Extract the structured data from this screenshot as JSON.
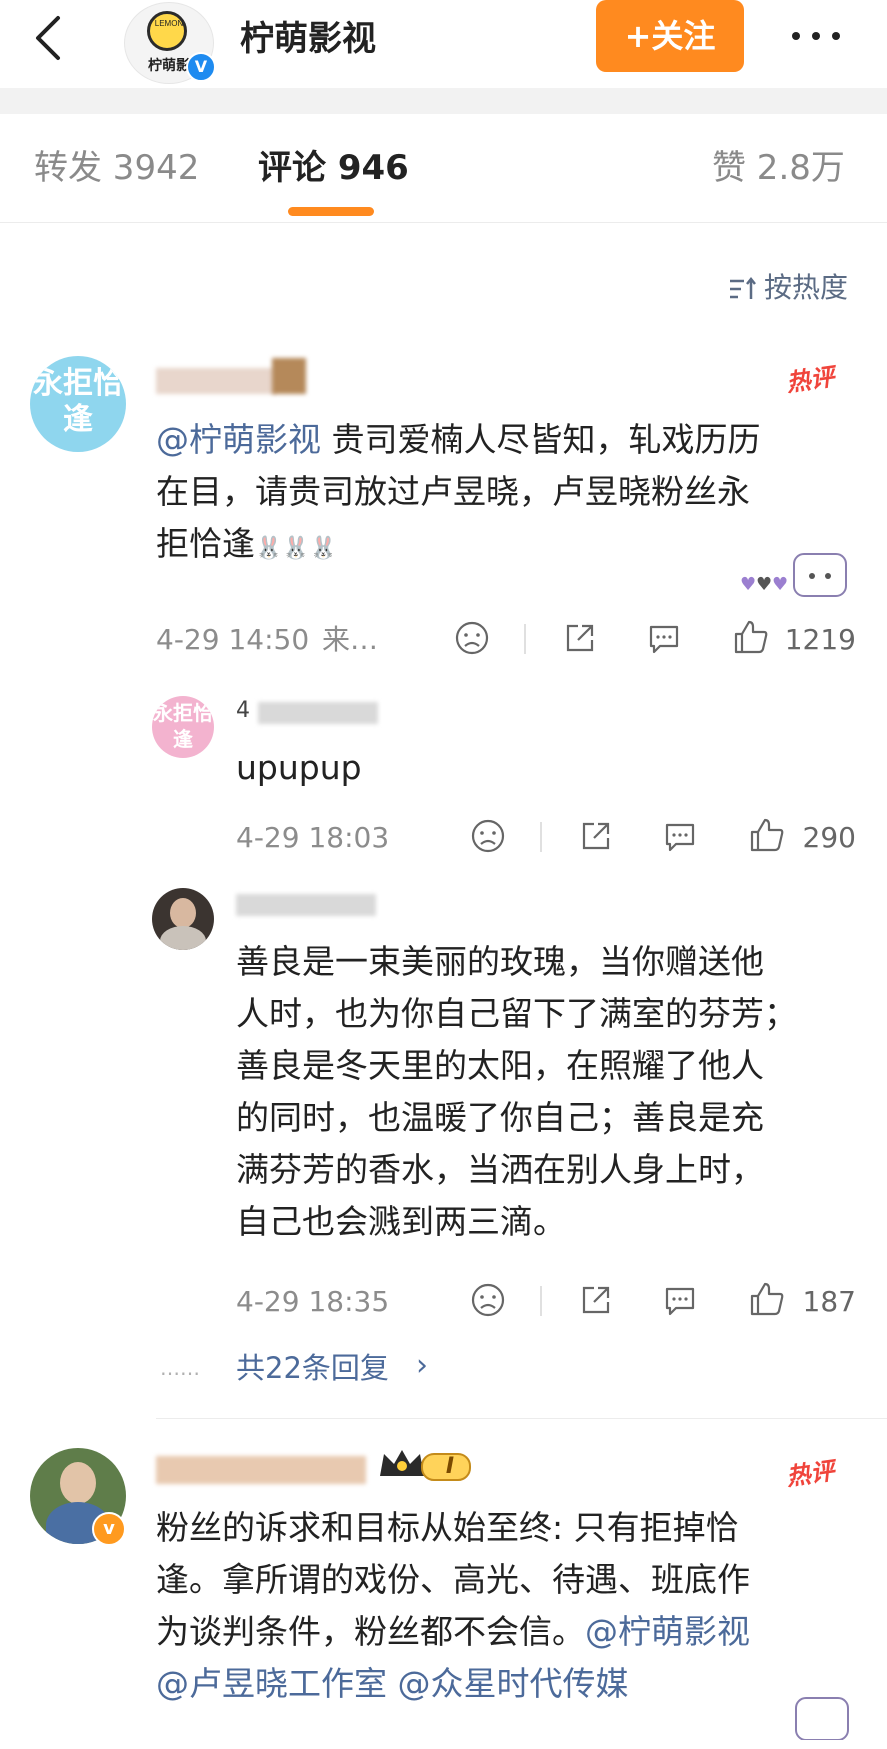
{
  "header": {
    "account_name": "柠萌影视",
    "logo_text_en": "LEMON",
    "logo_text_cn": "柠萌影",
    "verified_mark": "V",
    "follow_label": "+关注"
  },
  "tabs": {
    "repost": "转发 3942",
    "comments": "评论 946",
    "likes": "赞 2.8万"
  },
  "sort": {
    "label": "按热度"
  },
  "colors": {
    "accent": "#ff8a1f",
    "mention": "#4c6a9a",
    "hot": "#f0443b",
    "muted": "#8c8c8c"
  },
  "comments": [
    {
      "hot_label": "热评",
      "avatar_text": "永拒恰逢",
      "mention": "@柠萌影视",
      "text_line1": " 贵司爱楠人尽皆知，轧戏历历",
      "text_line2": "在目，请贵司放过卢昱晓，卢昱晓粉丝永",
      "text_line3": "拒恰逢",
      "time": "4-29 14:50",
      "source": "来…",
      "likes": "1219"
    },
    {
      "hot_label": "热评",
      "text_line1": "粉丝的诉求和目标从始至终: 只有拒掉恰",
      "text_line2": "逢。拿所谓的戏份、高光、待遇、班底作",
      "text_line3a": "为谈判条件，粉丝都不会信。",
      "mention1": "@柠萌影视",
      "mention2": "@卢昱晓工作室",
      "mention3": "@众星时代传媒",
      "badge_text": "I"
    }
  ],
  "replies": [
    {
      "avatar_text": "永拒恰逢",
      "name_fragment": "4",
      "text": "upupup",
      "time": "4-29 18:03",
      "likes": "290"
    },
    {
      "lines": [
        "善良是一束美丽的玫瑰，当你赠送他",
        "人时，也为你自己留下了满室的芬芳；",
        "善良是冬天里的太阳，在照耀了他人",
        "的同时，也温暖了你自己；善良是充",
        "满芬芳的香水，当洒在别人身上时，",
        "自己也会溅到两三滴。"
      ],
      "time": "4-29 18:35",
      "likes": "187"
    }
  ],
  "more_replies": {
    "dots": "……",
    "label": "共22条回复",
    "chevron": "›"
  }
}
